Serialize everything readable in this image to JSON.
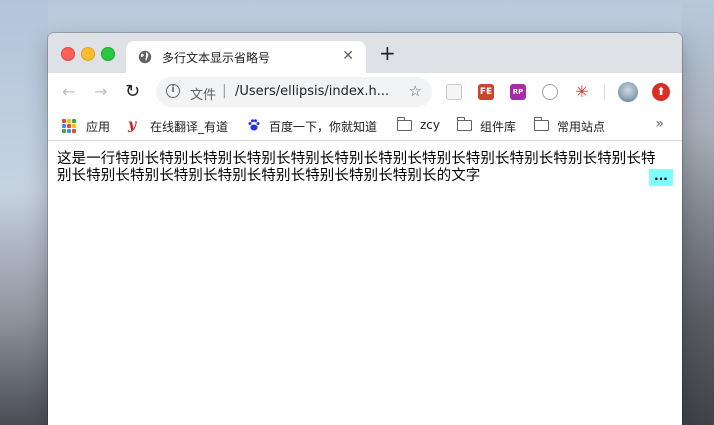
{
  "tab": {
    "title": "多行文本显示省略号",
    "close": "✕",
    "new_tab": "+"
  },
  "toolbar": {
    "back": "←",
    "forward": "→",
    "reload": "↻",
    "scheme_label": "文件",
    "url": "/Users/ellipsis/index.h...",
    "bookmark_star": "☆",
    "extensions": [
      "FE",
      "RP"
    ]
  },
  "bookmarks": {
    "items": [
      {
        "label": "应用",
        "icon": "apps-grid-icon"
      },
      {
        "label": "在线翻译_有道",
        "icon": "youdao-icon"
      },
      {
        "label": "百度一下，你就知道",
        "icon": "baidu-paw-icon"
      },
      {
        "label": "zcy",
        "icon": "folder-icon"
      },
      {
        "label": "组件库",
        "icon": "folder-icon"
      },
      {
        "label": "常用站点",
        "icon": "folder-icon"
      }
    ],
    "overflow": "»"
  },
  "page": {
    "text": "这是一行特别长特别长特别长特别长特别长特别长特别长特别长特别长特别长特别长特别长特别长特别长特别长特别长特别长特别长特别长特别长特别长的文字",
    "ellipsis": "..."
  },
  "colors": {
    "ellipsis_bg": "#7fffff",
    "tab_bar": "#dee1e6"
  }
}
